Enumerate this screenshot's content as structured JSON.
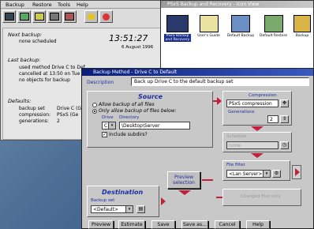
{
  "back_window": {
    "menu": [
      "Backup",
      "Restore",
      "Tools",
      "Help"
    ],
    "next_backup_label": "Next backup:",
    "next_backup_value": "none scheduled",
    "time": "13:51:27",
    "date": "6 August 1996",
    "last_backup_label": "Last backup:",
    "last_backup_lines": [
      "used method Drive C to Def",
      "cancelled at 13:50 on Tue 6",
      "no objects for backup"
    ],
    "defaults_label": "Defaults:",
    "defaults": [
      {
        "key": "backup set",
        "value": "Drive C (Ge"
      },
      {
        "key": "compression:",
        "value": "PSxS (Ge"
      },
      {
        "key": "generations:",
        "value": "2"
      }
    ]
  },
  "icon_window": {
    "title": "PSxS Backup and Recovery - Icon View",
    "icons": [
      {
        "label": "PSxS Backup and Recovery",
        "icon": "app-icon"
      },
      {
        "label": "User's Guide",
        "icon": "book-icon"
      },
      {
        "label": "Default Backup",
        "icon": "backup-icon"
      },
      {
        "label": "Default Restore",
        "icon": "restore-icon"
      },
      {
        "label": "Backup",
        "icon": "backup-folder-icon"
      }
    ]
  },
  "dialog": {
    "title": "Backup Method - Drive C to Default",
    "description_label": "Description",
    "description_value": "Back up Drive C to the default backup set",
    "source": {
      "title": "Source",
      "option_all": "Allow backup of all files",
      "option_below": "Only allow backup of files below:",
      "drive_label": "Drive",
      "directory_label": "Directory",
      "drive_value": "C",
      "directory_value": "\\Desktop\\Server",
      "include_subdirs": "Include subdirs?"
    },
    "compression": {
      "title": "Compression",
      "value": "PSxS compression"
    },
    "generations": {
      "title": "Generations",
      "value": "2"
    },
    "schedule": {
      "title": "Schedule",
      "value": "none"
    },
    "file_filter": {
      "title": "File filter",
      "value": "<Lan Server>"
    },
    "changed_files": {
      "title": "Changed files only"
    },
    "preview_selection": "Preview selection",
    "destination": {
      "title": "Destination",
      "backup_set_label": "Backup set",
      "backup_set_value": "<Default>"
    },
    "buttons": [
      "Preview",
      "Estimate",
      "Save",
      "Save as...",
      "Cancel",
      "Help"
    ]
  },
  "colors": {
    "accent": "#1d2fa3",
    "arrow": "#c0203a",
    "title_bar": "#0a1e7a",
    "desktop": "#4f7198"
  }
}
